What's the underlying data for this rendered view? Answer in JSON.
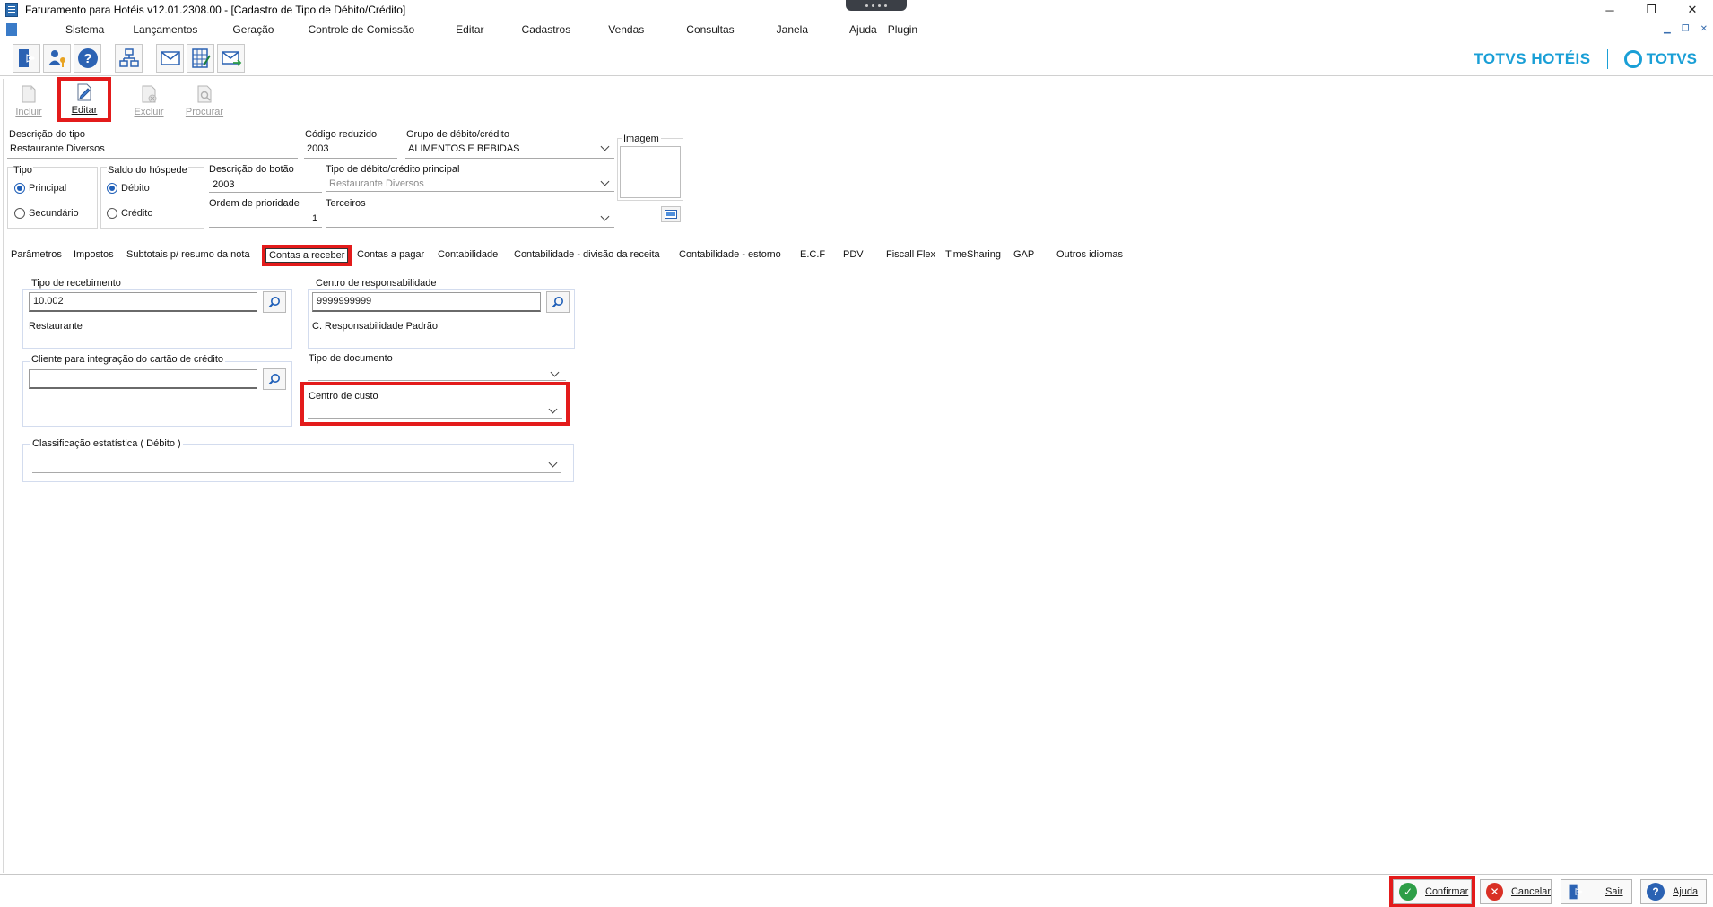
{
  "window": {
    "title": "Faturamento para Hotéis v12.01.2308.00 - [Cadastro de Tipo de Débito/Crédito]",
    "controls": [
      "─",
      "❐",
      "✕"
    ]
  },
  "menu": [
    "Sistema",
    "Lançamentos",
    "Geração",
    "Controle de Comissão",
    "Editar",
    "Cadastros",
    "Vendas",
    "Consultas",
    "Janela",
    "Ajuda",
    "Plugin"
  ],
  "toolbar_icons": [
    "exit-icon",
    "user-key-icon",
    "help-icon",
    "org-chart-icon",
    "mail-icon",
    "calculator-icon",
    "send-mail-icon"
  ],
  "brand": {
    "product": "TOTVS HOTÉIS",
    "company": "TOTVS",
    "color": "#1a9fd6"
  },
  "actions": {
    "incluir": "Incluir",
    "editar": "Editar",
    "excluir": "Excluir",
    "procurar": "Procurar"
  },
  "form": {
    "descricao_tipo": {
      "label": "Descrição do tipo",
      "value": "Restaurante  Diversos"
    },
    "codigo_reduzido": {
      "label": "Código reduzido",
      "value": "2003"
    },
    "grupo": {
      "label": "Grupo de débito/crédito",
      "value": "ALIMENTOS E BEBIDAS"
    },
    "imagem": {
      "label": "Imagem"
    },
    "tipo": {
      "label": "Tipo",
      "options": [
        "Principal",
        "Secundário"
      ],
      "selected": "Principal"
    },
    "saldo": {
      "label": "Saldo do hóspede",
      "options": [
        "Débito",
        "Crédito"
      ],
      "selected": "Débito"
    },
    "descricao_botao": {
      "label": "Descrição do botão",
      "value": "2003"
    },
    "ordem_prioridade": {
      "label": "Ordem de prioridade",
      "value": "1"
    },
    "tipo_principal": {
      "label": "Tipo de débito/crédito principal",
      "value": "Restaurante  Diversos"
    },
    "terceiros": {
      "label": "Terceiros",
      "value": ""
    }
  },
  "tabs": [
    "Parâmetros",
    "Impostos",
    "Subtotais p/ resumo da nota",
    "Contas a receber",
    "Contas a pagar",
    "Contabilidade",
    "Contabilidade - divisão da receita",
    "Contabilidade - estorno",
    "E.C.F",
    "PDV",
    "Fiscall Flex",
    "TimeSharing",
    "GAP",
    "Outros idiomas"
  ],
  "active_tab": "Contas a receber",
  "contas_receber": {
    "tipo_recebimento": {
      "label": "Tipo de recebimento",
      "value": "10.002",
      "description": "Restaurante"
    },
    "centro_responsabilidade": {
      "label": "Centro de responsabilidade",
      "value": "9999999999",
      "description": "C. Responsabilidade Padrão"
    },
    "cliente_cartao": {
      "label": "Cliente para integração do cartão de crédito",
      "value": ""
    },
    "tipo_documento": {
      "label": "Tipo de documento",
      "value": ""
    },
    "centro_custo": {
      "label": "Centro de custo",
      "value": ""
    },
    "classificacao": {
      "label": "Classificação estatística ( Débito )",
      "value": ""
    }
  },
  "bottom_buttons": {
    "confirmar": "Confirmar",
    "cancelar": "Cancelar",
    "sair": "Sair",
    "ajuda": "Ajuda"
  },
  "colors": {
    "highlight": "#e31b1b",
    "confirm": "#2e9e47",
    "cancel": "#d93025",
    "primary": "#1f5fb8"
  }
}
